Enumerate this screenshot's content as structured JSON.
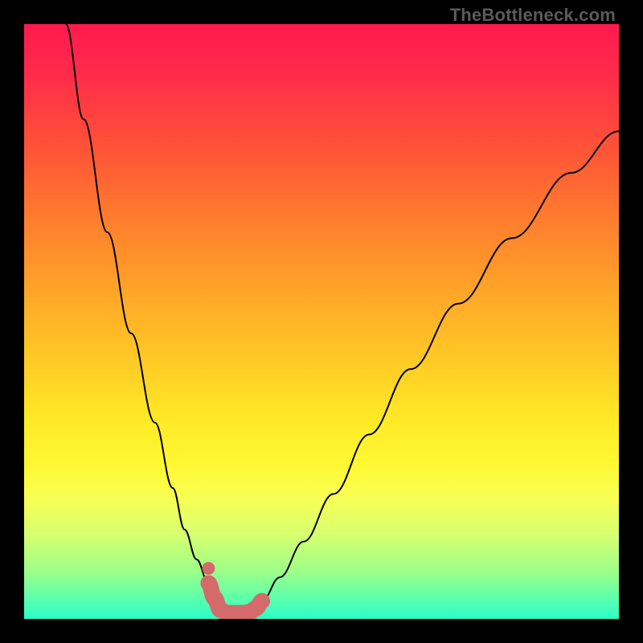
{
  "watermark": "TheBottleneck.com",
  "colors": {
    "curve": "#000000",
    "marker": "#d46a6a",
    "gradient_top": "#ff1a4d",
    "gradient_bottom": "#2affc8",
    "background": "#000000"
  },
  "chart_data": {
    "type": "line",
    "title": "",
    "xlabel": "",
    "ylabel": "",
    "xlim": [
      0,
      100
    ],
    "ylim": [
      0,
      100
    ],
    "grid": false,
    "legend": false,
    "series": [
      {
        "name": "left-curve",
        "x": [
          7,
          10,
          14,
          18,
          22,
          25,
          27,
          29,
          31,
          32,
          33,
          35
        ],
        "y": [
          100,
          84,
          65,
          48,
          33,
          22,
          15,
          10,
          6,
          4,
          3,
          1
        ]
      },
      {
        "name": "right-curve",
        "x": [
          38,
          40,
          43,
          47,
          52,
          58,
          65,
          73,
          82,
          92,
          100
        ],
        "y": [
          1,
          3,
          7,
          13,
          21,
          31,
          42,
          53,
          64,
          75,
          82
        ]
      },
      {
        "name": "optimal-markers",
        "x": [
          31,
          32,
          33,
          34,
          35,
          36,
          37,
          38,
          39,
          40
        ],
        "y": [
          6,
          3.5,
          1.5,
          1.0,
          1.0,
          1.0,
          1.0,
          1.2,
          1.8,
          3
        ]
      }
    ],
    "optimal_dot": {
      "x": 31,
      "y": 8.5
    }
  }
}
